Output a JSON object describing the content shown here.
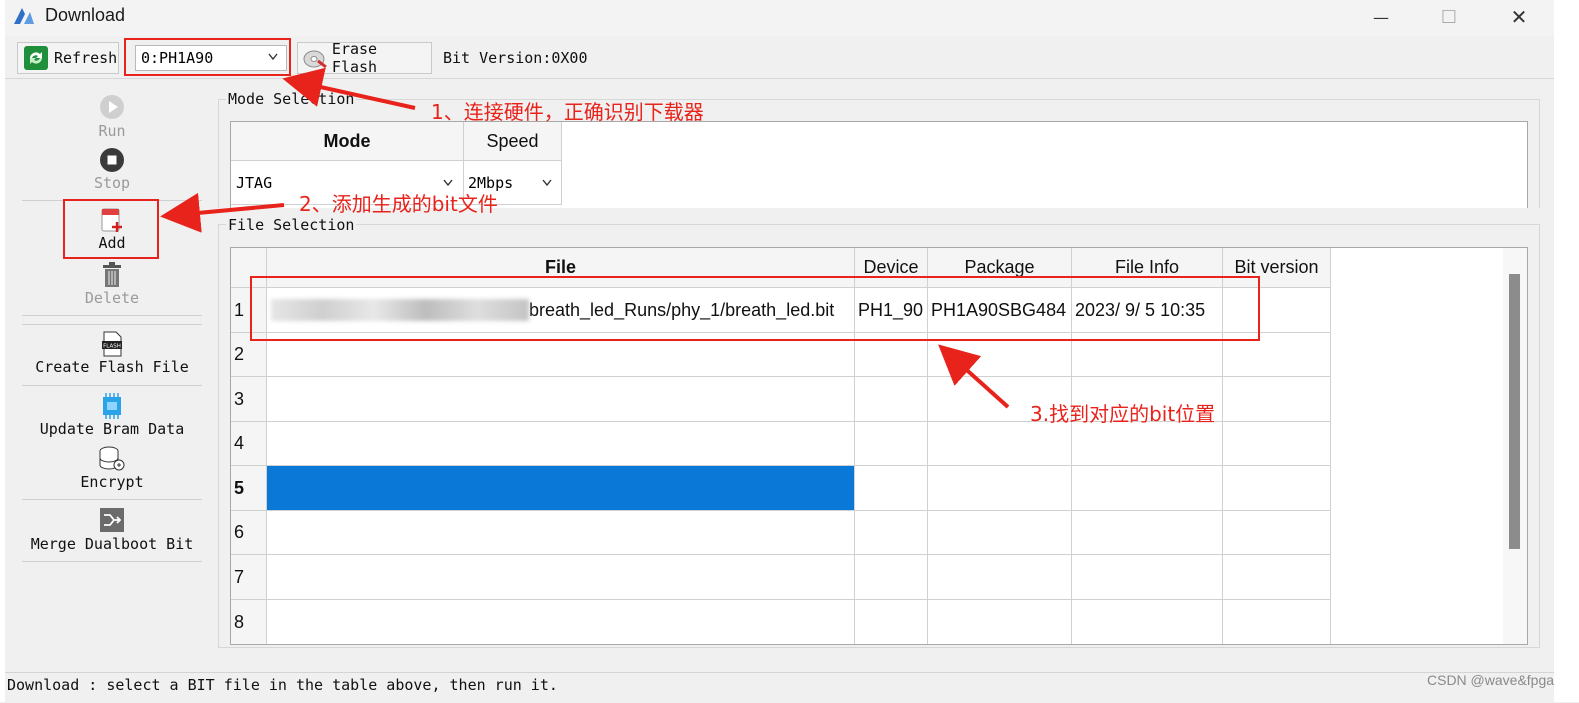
{
  "window": {
    "title": "Download",
    "minimize_glyph": "—",
    "maximize_glyph": "☐",
    "close_glyph": "✕"
  },
  "toolbar": {
    "refresh_label": "Refresh",
    "device_select": {
      "value": "0:PH1A90"
    },
    "erase_label": "Erase Flash",
    "bit_version": "Bit Version:0X00"
  },
  "sidebar": {
    "run_label": "Run",
    "stop_label": "Stop",
    "add_label": "Add",
    "delete_label": "Delete",
    "create_flash_label": "Create Flash File",
    "flash_icon_text": "FLASH",
    "update_bram_label": "Update Bram Data",
    "encrypt_label": "Encrypt",
    "merge_label": "Merge Dualboot Bit"
  },
  "mode_selection": {
    "group_label": "Mode Selection",
    "headers": [
      "Mode",
      "Speed"
    ],
    "mode_value": "JTAG",
    "speed_value": "2Mbps"
  },
  "file_selection": {
    "group_label": "File Selection",
    "headers": [
      "File",
      "Device",
      "Package",
      "File Info",
      "Bit version"
    ],
    "rows": [
      {
        "num": "1",
        "file": "breath_led_Runs/phy_1/breath_led.bit",
        "device": "PH1_90",
        "package": "PH1A90SBG484",
        "info": "2023/ 9/ 5 10:35",
        "bitver": ""
      },
      {
        "num": "2"
      },
      {
        "num": "3"
      },
      {
        "num": "4"
      },
      {
        "num": "5",
        "selected": true
      },
      {
        "num": "6"
      },
      {
        "num": "7"
      },
      {
        "num": "8"
      }
    ]
  },
  "annotations": {
    "step1": "1、连接硬件，正确识别下载器",
    "step2": "2、添加生成的bit文件",
    "step3": "3.找到对应的bit位置",
    "color": "#e8231b"
  },
  "status": {
    "text": "Download : select a BIT file in the table above, then run it."
  },
  "watermark": "CSDN @wave&fpga",
  "colors": {
    "selection": "#0a78d7",
    "accent_red": "#e8231b"
  }
}
